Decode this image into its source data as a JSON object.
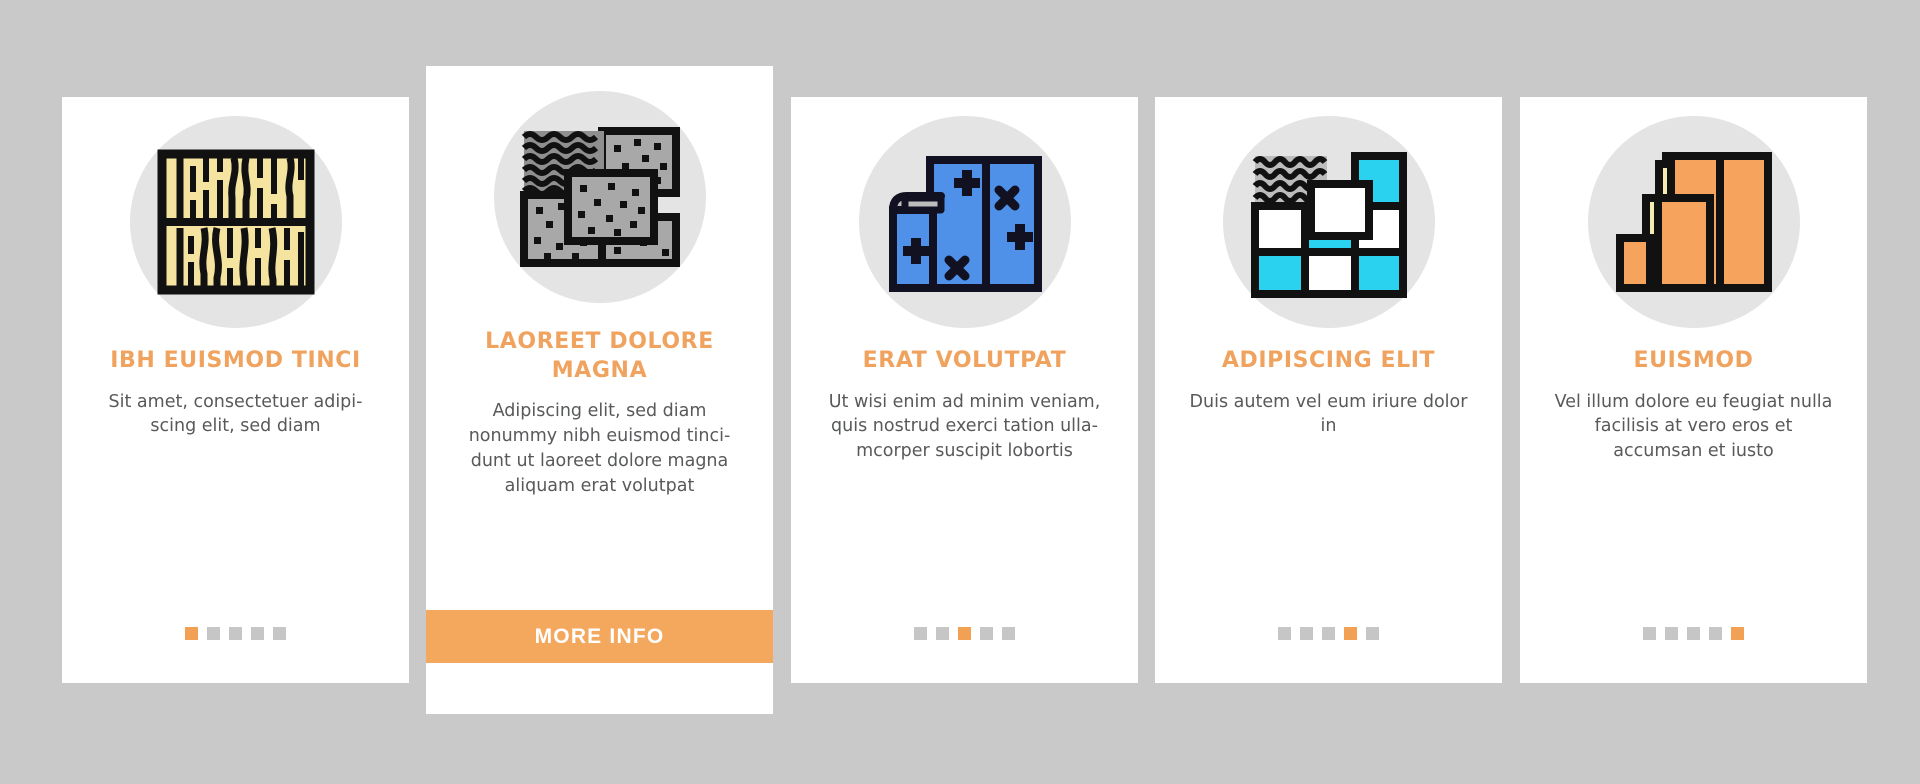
{
  "page": {
    "background_color": "#c9c9c9",
    "card_background": "#ffffff",
    "accent_color": "#f0a35e",
    "dot_inactive_color": "#c6c6c6",
    "body_text_color": "#58595b"
  },
  "cards": [
    {
      "icon_name": "wood-grain-texture-icon",
      "icon_colors": {
        "fill": "#f5e3a0",
        "stroke": "#111111"
      },
      "title": "IBH EUISMOD TINCI",
      "description": "Sit amet, consectetuer adipi-scing elit, sed diam",
      "dots": {
        "count": 5,
        "active_index": 0
      },
      "has_cta": false,
      "cta_label": ""
    },
    {
      "icon_name": "stone-tile-samples-icon",
      "icon_colors": {
        "fill": "#a8a8a8",
        "fill_alt": "#8f8f8f",
        "stroke": "#111111"
      },
      "title": "LAOREET DOLORE MAGNA",
      "description": "Adipiscing elit, sed diam nonummy nibh euismod tinci-dunt ut laoreet dolore magna aliquam erat volutpat",
      "dots": {
        "count": 0,
        "active_index": -1
      },
      "has_cta": true,
      "cta_label": "MORE INFO"
    },
    {
      "icon_name": "wallpaper-rolls-icon",
      "icon_colors": {
        "fill": "#4f91e8",
        "fill_alt": "#bdbdbd",
        "stroke": "#111122"
      },
      "title": "ERAT VOLUTPAT",
      "description": "Ut wisi enim ad minim veniam, quis nostrud exerci tation ulla-mcorper suscipit lobortis",
      "dots": {
        "count": 5,
        "active_index": 2
      },
      "has_cta": false,
      "cta_label": ""
    },
    {
      "icon_name": "ceramic-tile-grid-icon",
      "icon_colors": {
        "fill": "#2ad2f0",
        "fill_alt": "#ffffff",
        "fill_wave": "#bcbcbc",
        "stroke": "#111111"
      },
      "title": "ADIPISCING ELIT",
      "description": "Duis autem vel eum iriure dolor in",
      "dots": {
        "count": 5,
        "active_index": 3
      },
      "has_cta": false,
      "cta_label": ""
    },
    {
      "icon_name": "stacked-boards-icon",
      "icon_colors": {
        "fill": "#f6a35d",
        "fill_edge": "#f5ecb3",
        "stroke": "#111111"
      },
      "title": "EUISMOD",
      "description": "Vel illum dolore eu feugiat nulla facilisis at vero eros et accumsan et iusto",
      "dots": {
        "count": 5,
        "active_index": 4
      },
      "has_cta": false,
      "cta_label": ""
    }
  ]
}
